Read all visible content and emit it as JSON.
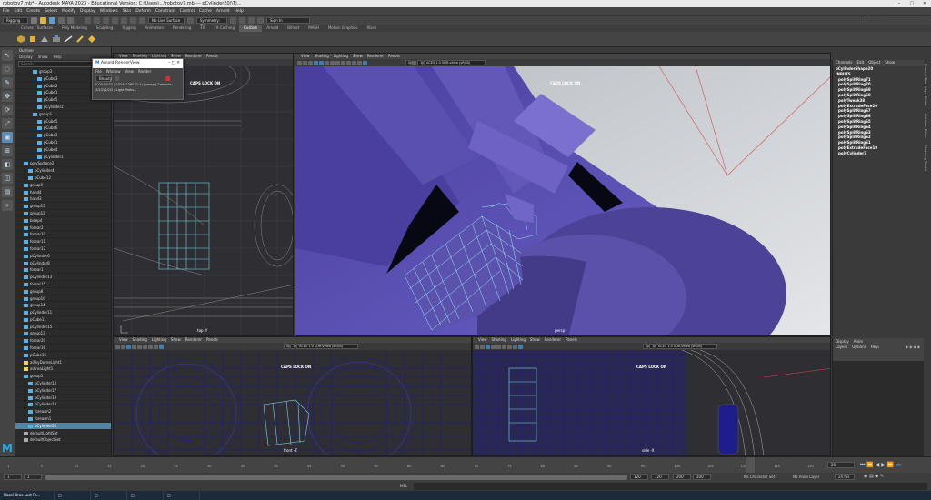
{
  "titlebar": {
    "text": "robotov7.mb* - Autodesk MAYA 2023 - Educational Version: C:\\Users\\...\\robotov7.mb --- pCylinder20|\\T|..."
  },
  "menu": [
    "File",
    "Edit",
    "Create",
    "Select",
    "Modify",
    "Display",
    "Windows",
    "Skin",
    "Deform",
    "Constrain",
    "Control",
    "Cache",
    "Arnold",
    "Help"
  ],
  "workspace": {
    "label": "Workspace :",
    "value": "General*"
  },
  "statusline": {
    "mode": "Rigging",
    "no_live": "No Live Surface",
    "symmetry": "Symmetry: Off",
    "signin": "Sign In"
  },
  "shelf_tabs": [
    "Curves / Surfaces",
    "Poly Modeling",
    "Sculpting",
    "Rigging",
    "Animation",
    "Rendering",
    "FX",
    "FX Caching",
    "Custom",
    "Arnold",
    "Bifrost",
    "MASH",
    "Motion Graphics",
    "XGen"
  ],
  "shelf_active": "Custom",
  "outliner": {
    "title": "Outliner",
    "menu": [
      "Display",
      "Show",
      "Help"
    ],
    "search_placeholder": "Search...",
    "items": [
      "group3",
      "pCube3",
      "pCube2",
      "pCube1",
      "pCube5",
      "pCylinder2",
      "group1",
      "pCube5",
      "pCube6",
      "pCube3",
      "pCube1",
      "pCube4",
      "pCylinder1",
      "polySurface2",
      "pCylinder4",
      "pCube12",
      "group9",
      "hand4",
      "hand3",
      "group15",
      "group12",
      "bicep4",
      "forear2",
      "forear10",
      "forear11",
      "forear12",
      "pCylinder6",
      "pCylinder8",
      "forear1",
      "pCylinder13",
      "forear15",
      "group8",
      "group10",
      "group14",
      "pCylinder11",
      "pCube11",
      "pCylinder15",
      "group13",
      "forear20",
      "forear16",
      "pCube16",
      "aiSkyDomeLight1",
      "aiAreaLight1",
      "group5",
      "pCylinder14",
      "pCylinder17",
      "pCylinder19",
      "pCylinder18",
      "forearm2",
      "forearm1",
      "pCylinder20",
      "defaultLightSet",
      "defaultObjectSet"
    ],
    "selected": "pCylinder20"
  },
  "arnold": {
    "title": "Arnold RenderView",
    "menu": [
      "File",
      "Window",
      "View",
      "Render"
    ],
    "mode": "Beauty",
    "status": "0 00:00:01 | 1024x1280 (1:1) | persp | Samples: 3/2/2/2/2/2 | Light Paths..."
  },
  "viewport": {
    "menu": [
      "View",
      "Shading",
      "Lighting",
      "Show",
      "Renderer",
      "Panels"
    ],
    "gamma": "0.00",
    "exposure": "1.00",
    "colorspace": "ACES 1.0 SDR-video (sRGB)",
    "caps": "CAPS LOCK ON",
    "cams": {
      "top": "top -Y",
      "persp": "persp",
      "front": "front -Z",
      "side": "side -X"
    }
  },
  "channelbox": {
    "menu": [
      "Channels",
      "Edit",
      "Object",
      "Show"
    ],
    "shape": "pCylinderShape20",
    "inputs_label": "INPUTS",
    "inputs": [
      "polySplitRing71",
      "polySplitRing70",
      "polySplitRing69",
      "polySplitRing68",
      "polyTweak38",
      "polyExtrudeFace20",
      "polySplitRing67",
      "polySplitRing66",
      "polySplitRing65",
      "polySplitRing64",
      "polySplitRing63",
      "polySplitRing62",
      "polySplitRing61",
      "polyExtrudeFace19",
      "polyCylinder7"
    ]
  },
  "layers": {
    "tabs": [
      "Display",
      "Anim"
    ],
    "menu": [
      "Layers",
      "Options",
      "Help"
    ]
  },
  "sidetabs": [
    "Channel Box / Layer Editor",
    "Attribute Editor",
    "Modeling Toolkit"
  ],
  "timeline": {
    "ticks": [
      "1",
      "5",
      "10",
      "15",
      "20",
      "25",
      "30",
      "35",
      "40",
      "45",
      "50",
      "55",
      "60",
      "65",
      "70",
      "75",
      "80",
      "85",
      "90",
      "95",
      "100",
      "105",
      "110",
      "115",
      "120"
    ],
    "current": "26",
    "end_field": "120"
  },
  "range": {
    "start": "1",
    "start2": "1",
    "end": "120",
    "end2": "120",
    "rend": "200",
    "rend2": "200",
    "charset": "No Character Set",
    "animlayer": "No Anim Layer",
    "fps": "24 fps"
  },
  "cmd": {
    "label": "MEL"
  },
  "taskbar": [
    "Hazel Bras Lost Fo...",
    "□",
    "□",
    "□",
    "□"
  ],
  "colors": {
    "accent": "#5285a6",
    "mesh": "#5a4fa8",
    "wire": "#1f1d8a"
  }
}
